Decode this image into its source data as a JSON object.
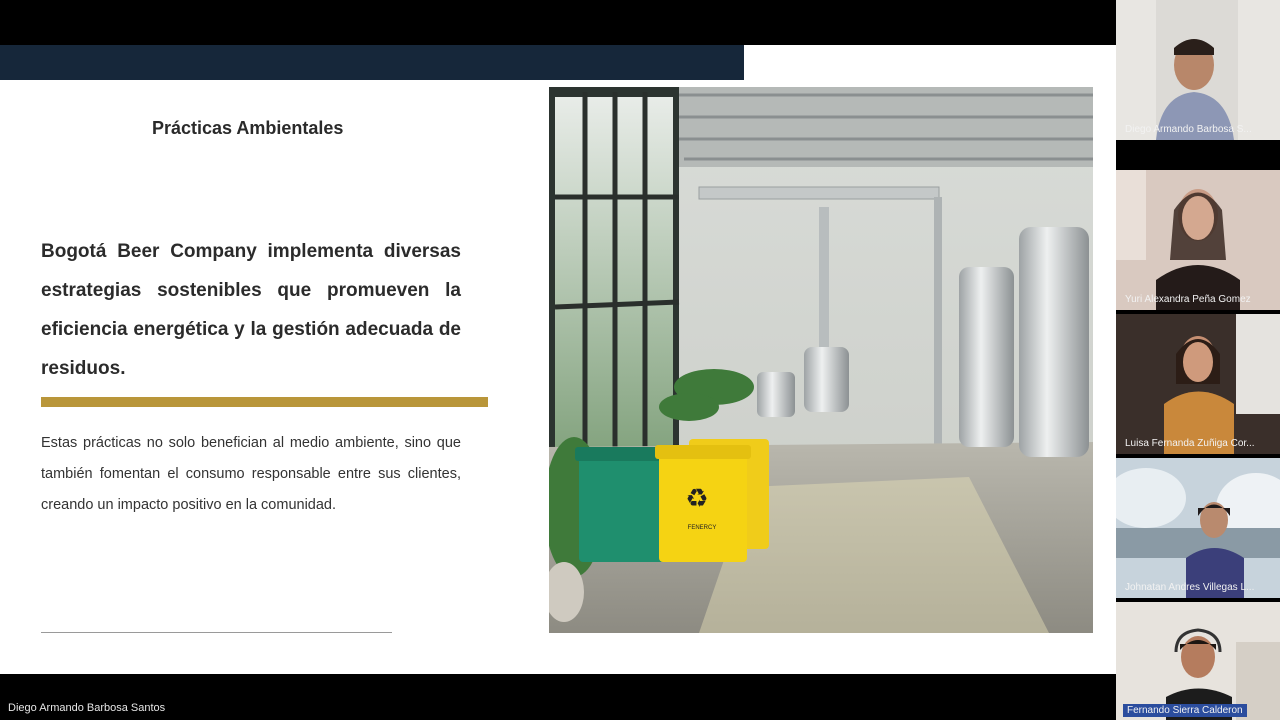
{
  "slide": {
    "title": "Prácticas Ambientales",
    "lead": "Bogotá Beer Company implementa diversas estrategias sostenibles que promueven la eficiencia energética y la gestión adecuada de residuos.",
    "body": "Estas prácticas no solo benefician al medio ambiente, sino que también fomentan el consumo responsable entre sus clientes, creando un impacto positivo en la comunidad.",
    "bin_label": "FENERCY"
  },
  "presenter": "Diego Armando Barbosa Santos",
  "participants": [
    {
      "name": "Diego Armando Barbosa S..."
    },
    {
      "name": "Yuri Alexandra Peña Gomez"
    },
    {
      "name": "Luisa Fernanda Zuñiga Cor..."
    },
    {
      "name": "Johnatan Andres Villegas L..."
    },
    {
      "name": "Fernando Sierra Calderon"
    }
  ],
  "colors": {
    "topbar": "#16273a",
    "accent_bar": "#b9963a",
    "active_speaker": "#2b4d9e"
  }
}
